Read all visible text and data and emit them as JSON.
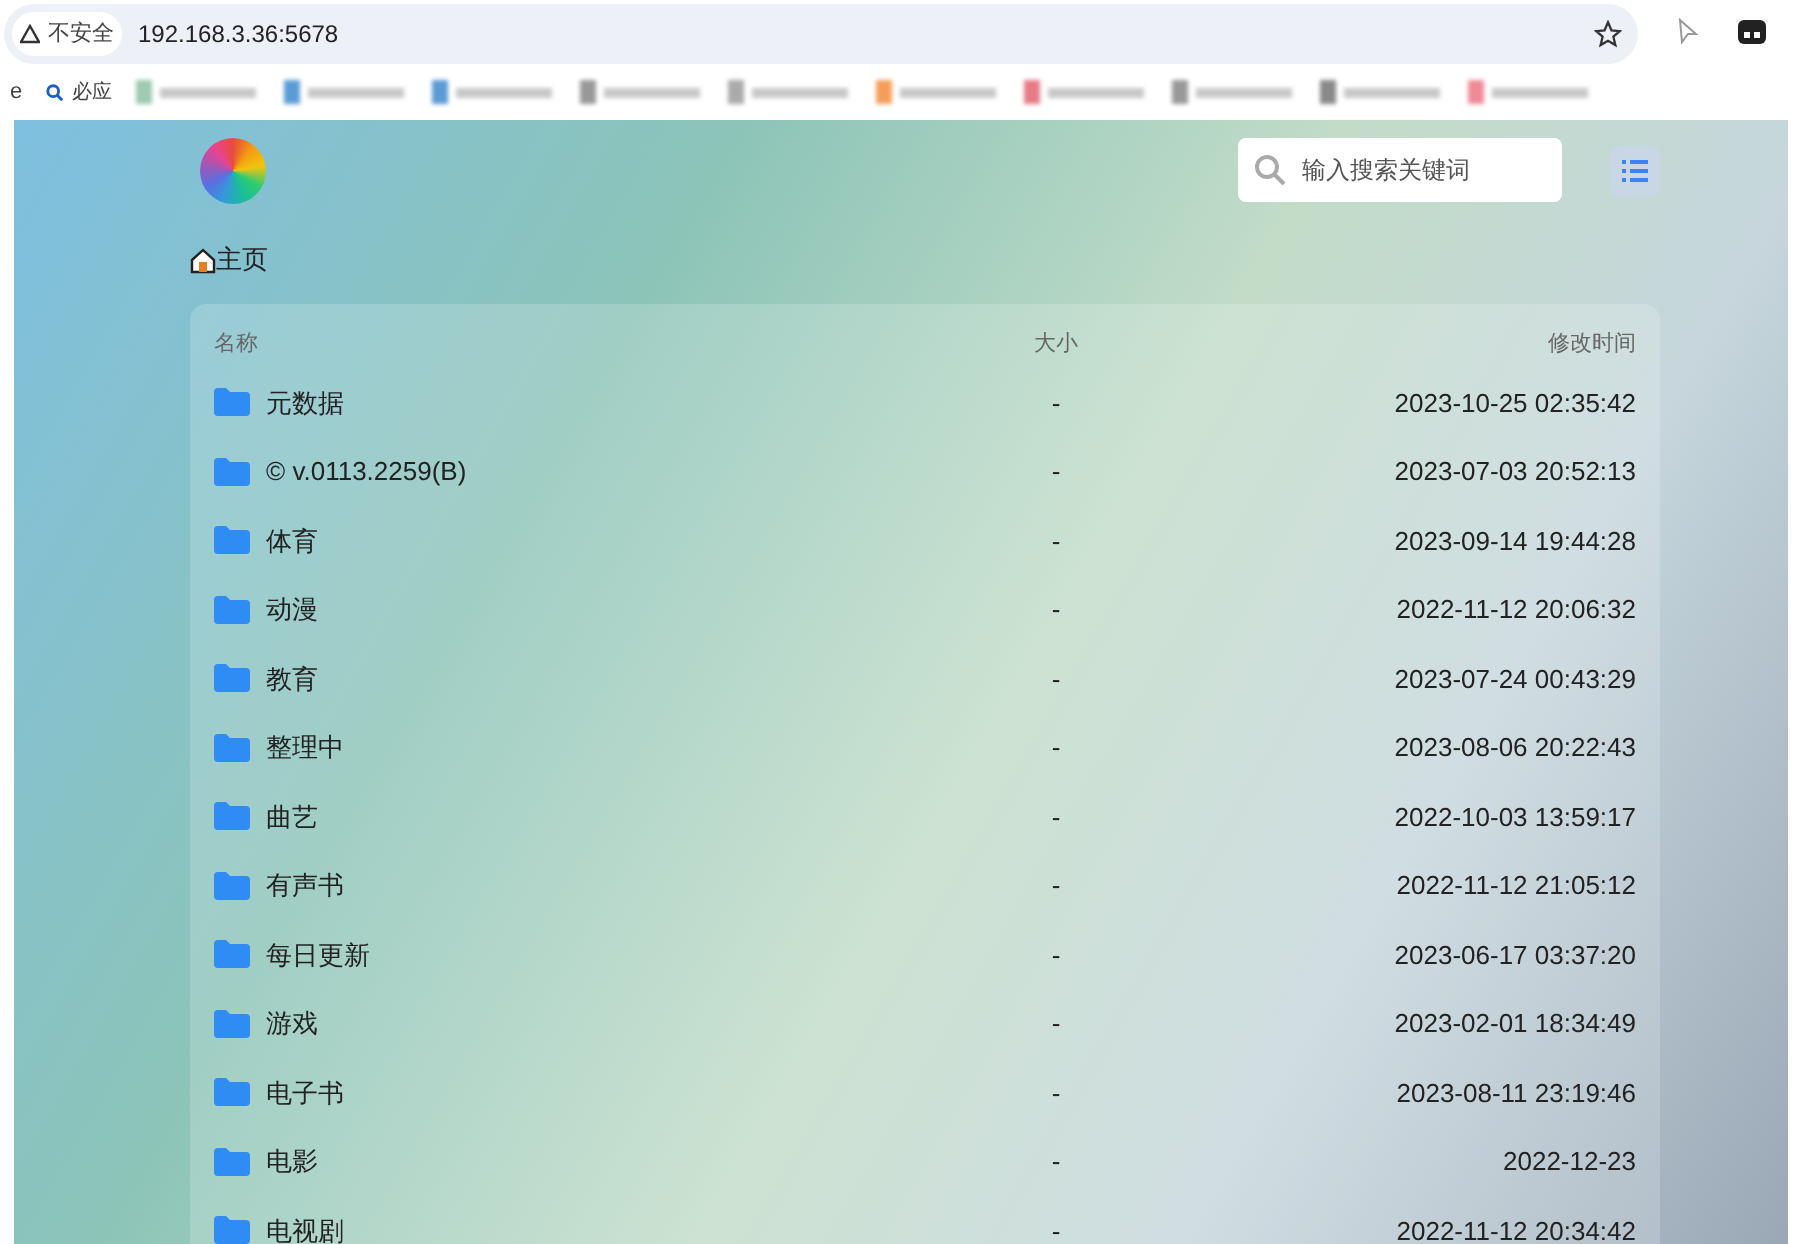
{
  "browser": {
    "security_label": "不安全",
    "url": "192.168.3.36:5678",
    "bookmarks": [
      "e",
      "必应"
    ]
  },
  "search": {
    "placeholder": "输入搜索关键词"
  },
  "breadcrumb": "主页",
  "table": {
    "columns": [
      "名称",
      "大小",
      "修改时间"
    ],
    "rows": [
      {
        "name": "元数据",
        "size": "-",
        "modified": "2023-10-25 02:35:42"
      },
      {
        "name": "© v.0113.2259(B)",
        "size": "-",
        "modified": "2023-07-03 20:52:13"
      },
      {
        "name": "体育",
        "size": "-",
        "modified": "2023-09-14 19:44:28"
      },
      {
        "name": "动漫",
        "size": "-",
        "modified": "2022-11-12 20:06:32"
      },
      {
        "name": "教育",
        "size": "-",
        "modified": "2023-07-24 00:43:29"
      },
      {
        "name": "整理中",
        "size": "-",
        "modified": "2023-08-06 20:22:43"
      },
      {
        "name": "曲艺",
        "size": "-",
        "modified": "2022-10-03 13:59:17"
      },
      {
        "name": "有声书",
        "size": "-",
        "modified": "2022-11-12 21:05:12"
      },
      {
        "name": "每日更新",
        "size": "-",
        "modified": "2023-06-17 03:37:20"
      },
      {
        "name": "游戏",
        "size": "-",
        "modified": "2023-02-01 18:34:49"
      },
      {
        "name": "电子书",
        "size": "-",
        "modified": "2023-08-11 23:19:46"
      },
      {
        "name": "电影",
        "size": "-",
        "modified": "2022-12-23"
      },
      {
        "name": "电视剧",
        "size": "-",
        "modified": "2022-11-12 20:34:42"
      }
    ]
  }
}
